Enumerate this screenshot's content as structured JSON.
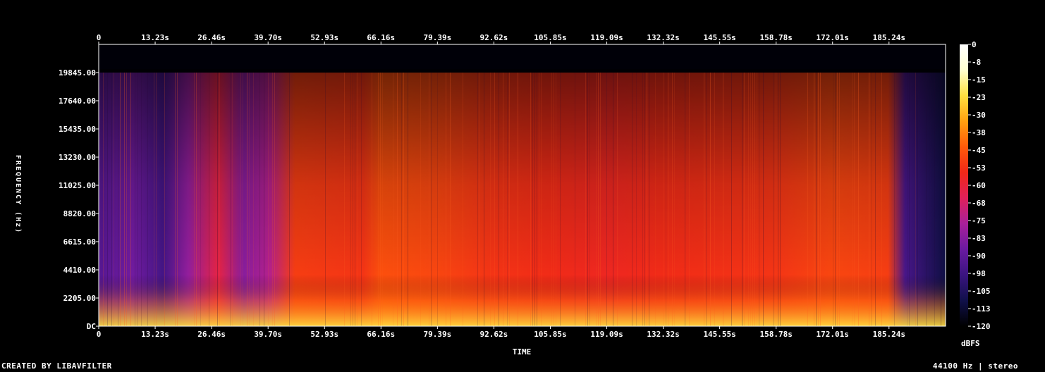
{
  "chart_data": {
    "type": "heatmap",
    "title": "",
    "xlabel": "TIME",
    "ylabel": "FREQUENCY (Hz)",
    "x_ticks": [
      "0",
      "13.23s",
      "26.46s",
      "39.70s",
      "52.93s",
      "66.16s",
      "79.39s",
      "92.62s",
      "105.85s",
      "119.09s",
      "132.32s",
      "145.55s",
      "158.78s",
      "172.01s",
      "185.24s"
    ],
    "x_tick_seconds": [
      0,
      13.23,
      26.46,
      39.7,
      52.93,
      66.16,
      79.39,
      92.62,
      105.85,
      119.09,
      132.32,
      145.55,
      158.78,
      172.01,
      185.24
    ],
    "x_range_seconds": [
      0,
      198.5
    ],
    "y_ticks": [
      "DC",
      "2205.00",
      "4410.00",
      "6615.00",
      "8820.00",
      "11025.00",
      "13230.00",
      "15435.00",
      "17640.00",
      "19845.00"
    ],
    "y_tick_hz": [
      0,
      2205,
      4410,
      6615,
      8820,
      11025,
      13230,
      15435,
      17640,
      19845
    ],
    "y_range_hz": [
      0,
      22050
    ],
    "colorbar": {
      "label": "dBFS",
      "ticks": [
        "0",
        "-8",
        "-15",
        "-23",
        "-30",
        "-38",
        "-45",
        "-53",
        "-60",
        "-68",
        "-75",
        "-83",
        "-90",
        "-98",
        "-105",
        "-113",
        "-120"
      ],
      "range": [
        -120,
        0
      ],
      "colormap": [
        "#000000",
        "#10104a",
        "#3a1480",
        "#6a1aa0",
        "#a8209a",
        "#e0205a",
        "#f02818",
        "#ff5a0a",
        "#ffa010",
        "#ffe040",
        "#ffffd0",
        "#ffffff"
      ]
    },
    "cutoff_hz": 19845,
    "average_level_dbfs": [
      {
        "t": 0,
        "level": -92
      },
      {
        "t": 8,
        "level": -86
      },
      {
        "t": 15,
        "level": -96
      },
      {
        "t": 21,
        "level": -80
      },
      {
        "t": 28,
        "level": -62
      },
      {
        "t": 34,
        "level": -82
      },
      {
        "t": 40,
        "level": -74
      },
      {
        "t": 46,
        "level": -50
      },
      {
        "t": 62,
        "level": -52
      },
      {
        "t": 66,
        "level": -46
      },
      {
        "t": 79,
        "level": -48
      },
      {
        "t": 92,
        "level": -52
      },
      {
        "t": 106,
        "level": -54
      },
      {
        "t": 119,
        "level": -56
      },
      {
        "t": 132,
        "level": -54
      },
      {
        "t": 158,
        "level": -52
      },
      {
        "t": 172,
        "level": -48
      },
      {
        "t": 185,
        "level": -50
      },
      {
        "t": 189,
        "level": -95
      },
      {
        "t": 198.5,
        "level": -110
      }
    ],
    "grid": false
  },
  "footer": {
    "left": "CREATED BY LIBAVFILTER",
    "right": "44100 Hz | stereo"
  }
}
